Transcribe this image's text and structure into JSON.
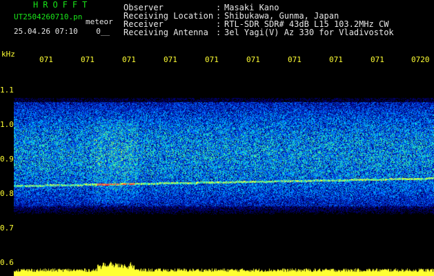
{
  "header": {
    "brand": "HROFFT",
    "filename": "UT2504260710.pn",
    "tag": "meteor",
    "datetime": "25.04.26 07:10    0__"
  },
  "meta": [
    {
      "label": "Observer",
      "value": "Masaki Kano"
    },
    {
      "label": "Receiving Location",
      "value": "Shibukawa, Gunma, Japan"
    },
    {
      "label": "Receiver",
      "value": "RTL-SDR SDR# 43dB L15 103.2MHz CW"
    },
    {
      "label": "Receiving Antenna",
      "value": "3el Yagi(V) Az 330 for Vladivostok"
    }
  ],
  "axis": {
    "unit": "kHz",
    "time_ticks": [
      "071",
      "071",
      "071",
      "071",
      "071",
      "071",
      "071",
      "071",
      "071",
      "0720"
    ],
    "freq_ticks": [
      "1.1",
      "1.0",
      "0.9",
      "0.8",
      "0.7",
      "0.6"
    ]
  },
  "colors": {
    "text_green": "#19e619",
    "text_white": "#e8e8e8",
    "axis_yellow": "#ffff33",
    "background": "#000000"
  },
  "plot": {
    "freq_range_khz": [
      0.6,
      1.1
    ],
    "signal_band_khz": [
      0.78,
      1.04
    ],
    "carrier_khz": 0.83
  }
}
